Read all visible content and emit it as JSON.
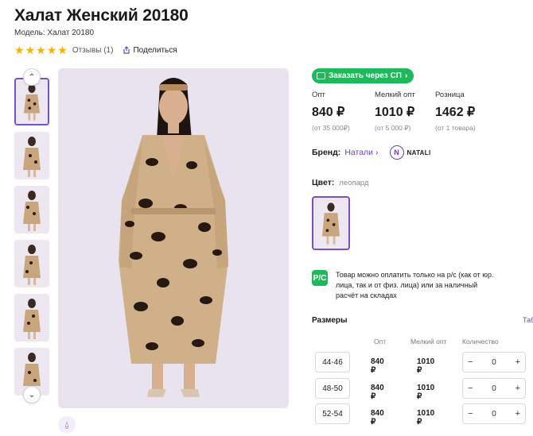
{
  "product": {
    "title": "Халат Женский 20180",
    "model": "Модель: Халат 20180",
    "rating": 5,
    "reviews": "Отзывы (1)",
    "share": "Поделиться"
  },
  "order_button": "Заказать через СП",
  "prices": [
    {
      "label": "Опт",
      "value": "840 ₽",
      "note": "(от 35 000₽)"
    },
    {
      "label": "Мелкий опт",
      "value": "1010 ₽",
      "note": "(от 5 000 ₽)"
    },
    {
      "label": "Розница",
      "value": "1462 ₽",
      "note": "(от 1 товара)"
    }
  ],
  "brand": {
    "label": "Бренд:",
    "name": "Натали",
    "logo_text": "NATALI",
    "logo_letter": "N"
  },
  "color": {
    "label": "Цвет:",
    "value": "леопард"
  },
  "payment": {
    "icon_text": "Р/С",
    "text": "Товар можно оплатить только на р/с (как от юр. лица, так и от физ. лица) или за наличный расчёт на складах"
  },
  "sizes": {
    "title": "Размеры",
    "table_link": "Таб",
    "headers": {
      "opt": "Опт",
      "small_opt": "Мелкий опт",
      "qty": "Количество"
    },
    "rows": [
      {
        "size": "44-46",
        "opt": "840 ₽",
        "small_opt": "1010 ₽",
        "qty": "0"
      },
      {
        "size": "48-50",
        "opt": "840 ₽",
        "small_opt": "1010 ₽",
        "qty": "0"
      },
      {
        "size": "52-54",
        "opt": "840 ₽",
        "small_opt": "1010 ₽",
        "qty": "0"
      }
    ]
  },
  "icons": {
    "minus": "−",
    "plus": "+",
    "star": "★",
    "chevron_up": "⌃",
    "chevron_down": "⌄",
    "arrow_right": "›"
  },
  "colors": {
    "accent": "#7b4fc8",
    "green": "#1db95a",
    "star": "#f5b301"
  }
}
